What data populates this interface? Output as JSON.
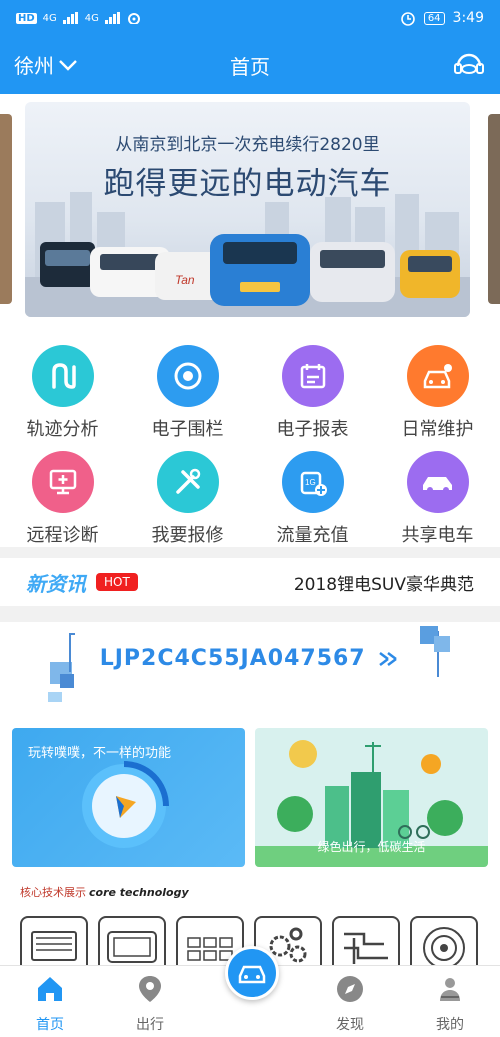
{
  "status": {
    "left_hd": "HD",
    "left_net1": "4G",
    "left_net2": "4G",
    "battery": "64",
    "time": "3:49"
  },
  "header": {
    "city": "徐州",
    "title": "首页"
  },
  "banner": {
    "subtitle": "从南京到北京一次充电续行2820里",
    "title": "跑得更远的电动汽车"
  },
  "grid": {
    "items": [
      {
        "label": "轨迹分析",
        "color": "#2bc8d6"
      },
      {
        "label": "电子围栏",
        "color": "#2d9cf0"
      },
      {
        "label": "电子报表",
        "color": "#9c6cf0"
      },
      {
        "label": "日常维护",
        "color": "#ff7a2e"
      },
      {
        "label": "远程诊断",
        "color": "#f0608a"
      },
      {
        "label": "我要报修",
        "color": "#2bc8d6"
      },
      {
        "label": "流量充值",
        "color": "#2d9cf0"
      },
      {
        "label": "共享电车",
        "color": "#9c6cf0"
      }
    ]
  },
  "news": {
    "title": "新资讯",
    "badge": "HOT",
    "text": "2018锂电SUV豪华典范"
  },
  "vin": "LJP2C4C55JA047567",
  "cards": {
    "left_title": "玩转噗噗，不一样的功能",
    "right_caption": "绿色出行，低碳生活"
  },
  "core": {
    "title_cn": "核心技术展示",
    "title_en": "core technology"
  },
  "tabbar": {
    "home": "首页",
    "travel": "出行",
    "discover": "发现",
    "mine": "我的"
  },
  "colors": {
    "primary": "#2196f3",
    "hot": "#f02020"
  }
}
